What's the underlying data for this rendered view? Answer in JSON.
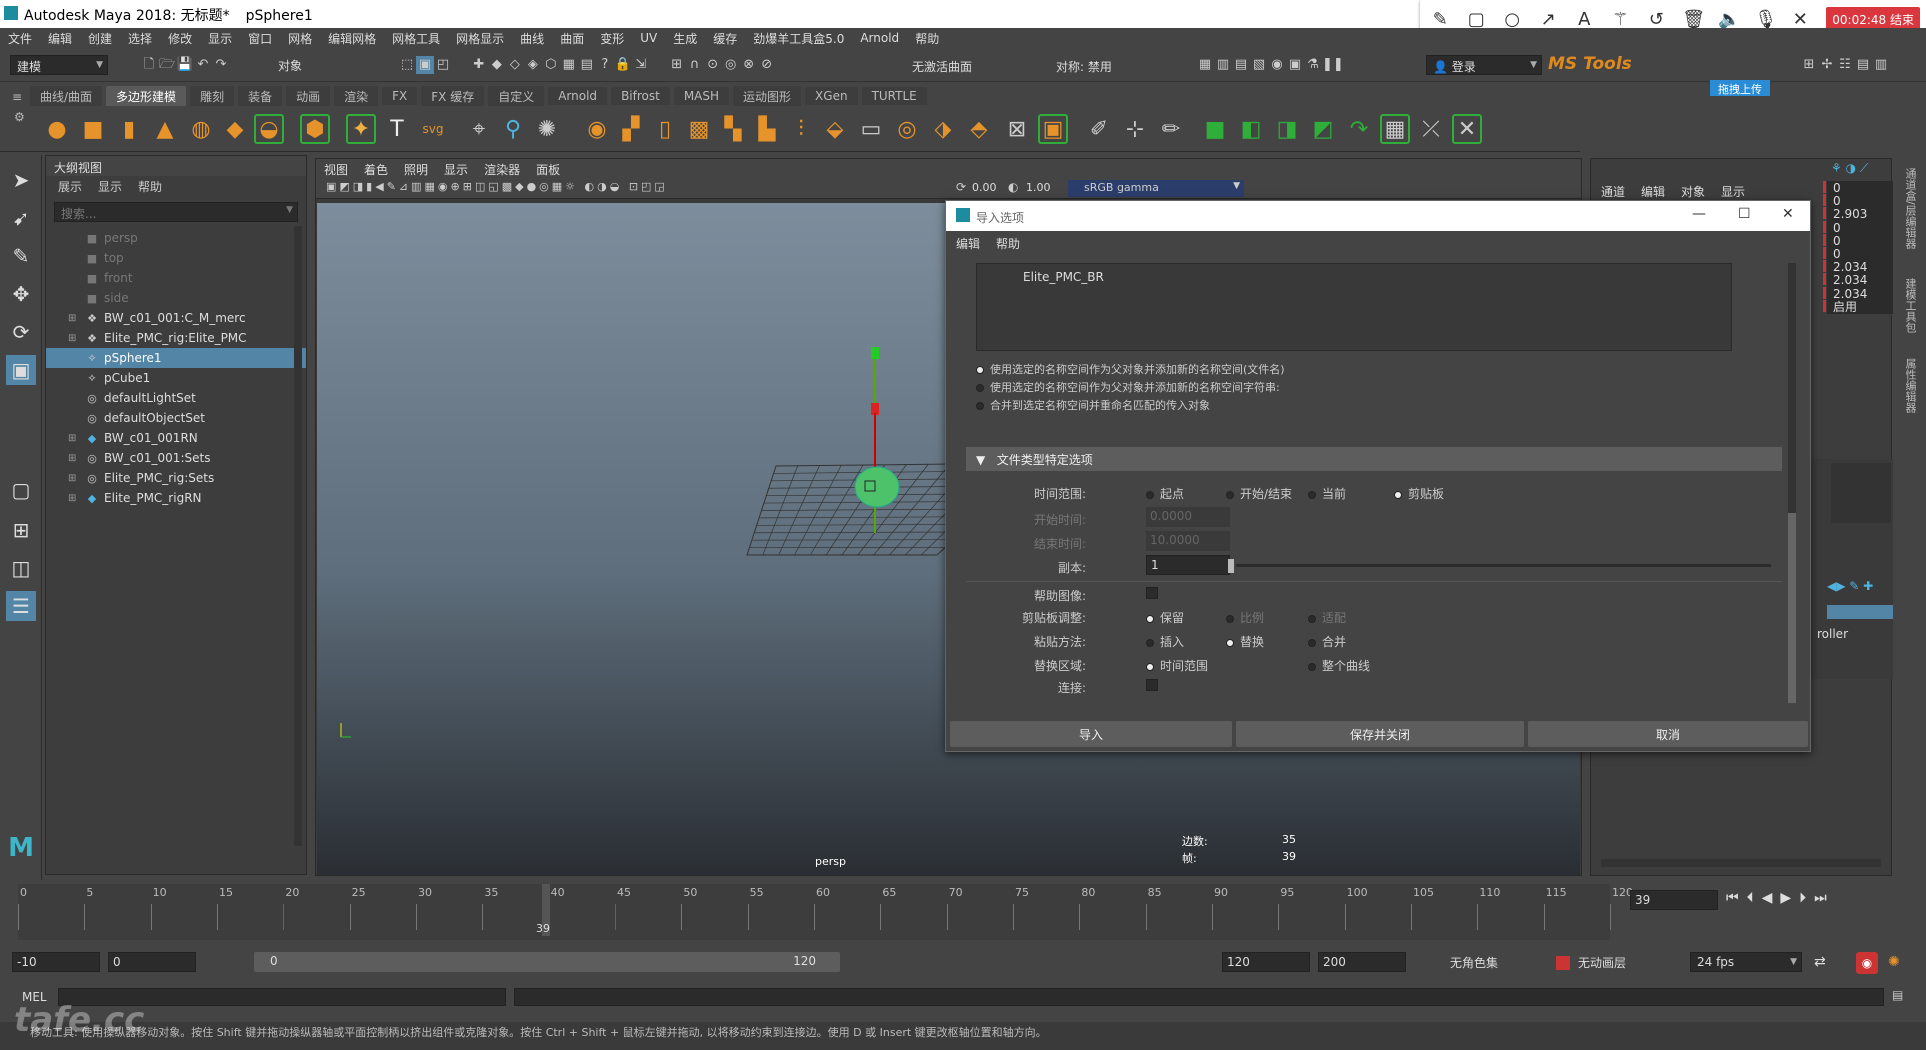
{
  "window": {
    "title": "Autodesk Maya 2018: 无标题*",
    "selection": "pSphere1"
  },
  "recorder": {
    "time": "00:02:48 结束",
    "icons": [
      "pencil-icon",
      "rectangle-icon",
      "circle-icon",
      "arrow-icon",
      "text-icon",
      "magic-icon",
      "undo-icon",
      "trash-icon",
      "speaker-icon",
      "mic-icon",
      "close-icon"
    ]
  },
  "menubar": [
    "文件",
    "编辑",
    "创建",
    "选择",
    "修改",
    "显示",
    "窗口",
    "网格",
    "编辑网格",
    "网格工具",
    "网格显示",
    "曲线",
    "曲面",
    "变形",
    "UV",
    "生成",
    "缓存",
    "劲爆羊工具盒5.0",
    "Arnold",
    "帮助"
  ],
  "statusline": {
    "mode": "建模",
    "object_field": "对象",
    "live_surface": "无激活曲面",
    "symmetry": "对称: 禁用",
    "login": "登录",
    "brand": "MS Tools",
    "upload": "拖拽上传"
  },
  "shelf_tabs": [
    "曲线/曲面",
    "多边形建模",
    "雕刻",
    "装备",
    "动画",
    "渲染",
    "FX",
    "FX 缓存",
    "自定义",
    "Arnold",
    "Bifrost",
    "MASH",
    "运动图形",
    "XGen",
    "TURTLE"
  ],
  "shelf_active_tab": "多边形建模",
  "outliner": {
    "title": "大纲视图",
    "menu": [
      "展示",
      "显示",
      "帮助"
    ],
    "search_placeholder": "搜索...",
    "items": [
      {
        "label": "persp",
        "icon": "camera-icon",
        "dim": true,
        "expander": ""
      },
      {
        "label": "top",
        "icon": "camera-icon",
        "dim": true,
        "expander": ""
      },
      {
        "label": "front",
        "icon": "camera-icon",
        "dim": true,
        "expander": ""
      },
      {
        "label": "side",
        "icon": "camera-icon",
        "dim": true,
        "expander": ""
      },
      {
        "label": "BW_c01_001:C_M_merc",
        "icon": "reference-icon",
        "dim": false,
        "expander": "⊞"
      },
      {
        "label": "Elite_PMC_rig:Elite_PMC",
        "icon": "reference-icon",
        "dim": false,
        "expander": "⊞"
      },
      {
        "label": "pSphere1",
        "icon": "transform-icon",
        "dim": false,
        "expander": "",
        "selected": true
      },
      {
        "label": "pCube1",
        "icon": "transform-icon",
        "dim": false,
        "expander": ""
      },
      {
        "label": "defaultLightSet",
        "icon": "set-icon",
        "dim": false,
        "expander": ""
      },
      {
        "label": "defaultObjectSet",
        "icon": "set-icon",
        "dim": false,
        "expander": ""
      },
      {
        "label": "BW_c01_001RN",
        "icon": "refnode-icon",
        "dim": false,
        "expander": "⊞"
      },
      {
        "label": "BW_c01_001:Sets",
        "icon": "set-icon",
        "dim": false,
        "expander": "⊞"
      },
      {
        "label": "Elite_PMC_rig:Sets",
        "icon": "set-icon",
        "dim": false,
        "expander": "⊞"
      },
      {
        "label": "Elite_PMC_rigRN",
        "icon": "refnode-icon",
        "dim": false,
        "expander": "⊞"
      }
    ]
  },
  "viewport": {
    "menu": [
      "视图",
      "着色",
      "照明",
      "显示",
      "渲染器",
      "面板"
    ],
    "exposure": "0.00",
    "gamma": "1.00",
    "color_space": "sRGB gamma",
    "camera": "persp",
    "hud": [
      {
        "label": "边数:",
        "value": "35"
      },
      {
        "label": "帧:",
        "value": "39"
      }
    ]
  },
  "dialog": {
    "title": "导入选项",
    "menu": [
      "编辑",
      "帮助"
    ],
    "list_item": "Elite_PMC_BR",
    "namespace_options": [
      {
        "label": "使用选定的名称空间作为父对象并添加新的名称空间(文件名)",
        "on": true
      },
      {
        "label": "使用选定的名称空间作为父对象并添加新的名称空间字符串:",
        "on": false
      },
      {
        "label": "合并到选定名称空间并重命名匹配的传入对象",
        "on": false
      }
    ],
    "section": "文件类型特定选项",
    "time_range": {
      "label": "时间范围:",
      "options": [
        "起点",
        "开始/结束",
        "当前",
        "剪贴板"
      ],
      "selected": "剪贴板"
    },
    "start_time": {
      "label": "开始时间:",
      "value": "0.0000"
    },
    "end_time": {
      "label": "结束时间:",
      "value": "10.0000"
    },
    "copies": {
      "label": "副本:",
      "value": "1"
    },
    "help_images": {
      "label": "帮助图像:"
    },
    "clipboard_adjust": {
      "label": "剪贴板调整:",
      "options": [
        "保留",
        "比例",
        "适配"
      ],
      "selected": "保留"
    },
    "paste_method": {
      "label": "粘贴方法:",
      "options": [
        "插入",
        "替换",
        "合并"
      ],
      "selected": "替换"
    },
    "replace_region": {
      "label": "替换区域:",
      "options": [
        "时间范围",
        "整个曲线"
      ],
      "selected": "时间范围"
    },
    "connect": {
      "label": "连接:"
    },
    "buttons": {
      "import": "导入",
      "save_close": "保存并关闭",
      "cancel": "取消"
    }
  },
  "channel_box": {
    "menu": [
      "通道",
      "编辑",
      "对象",
      "显示"
    ],
    "values": [
      "0",
      "0",
      "2.903",
      "0",
      "0",
      "0",
      "2.034",
      "2.034",
      "2.034",
      "启用"
    ],
    "side_tabs": [
      "通道盒/层编辑器",
      "建模工具包",
      "属性编辑器"
    ],
    "partial_label": "roller"
  },
  "timeslider": {
    "ticks": [
      "0",
      "5",
      "10",
      "15",
      "20",
      "25",
      "30",
      "35",
      "40",
      "45",
      "50",
      "55",
      "60",
      "65",
      "70",
      "75",
      "80",
      "85",
      "90",
      "95",
      "100",
      "105",
      "110",
      "115",
      "120"
    ],
    "current": "39",
    "current_field": "39"
  },
  "range": {
    "scene_start": "-10",
    "start": "0",
    "slider_start": "0",
    "slider_end": "120",
    "end": "120",
    "scene_end": "200",
    "char_set": "无角色集",
    "anim_layer": "无动画层",
    "fps": "24 fps"
  },
  "cmd": {
    "label": "MEL"
  },
  "help_line": "移动工具: 使用操纵器移动对象。按住 Shift 键并拖动操纵器轴或平面控制柄以挤出组件或克隆对象。按住 Ctrl + Shift + 鼠标左键并拖动, 以将移动约束到连接边。使用 D 或 Insert 键更改枢轴位置和轴方向。",
  "watermark": "tafe.cc"
}
